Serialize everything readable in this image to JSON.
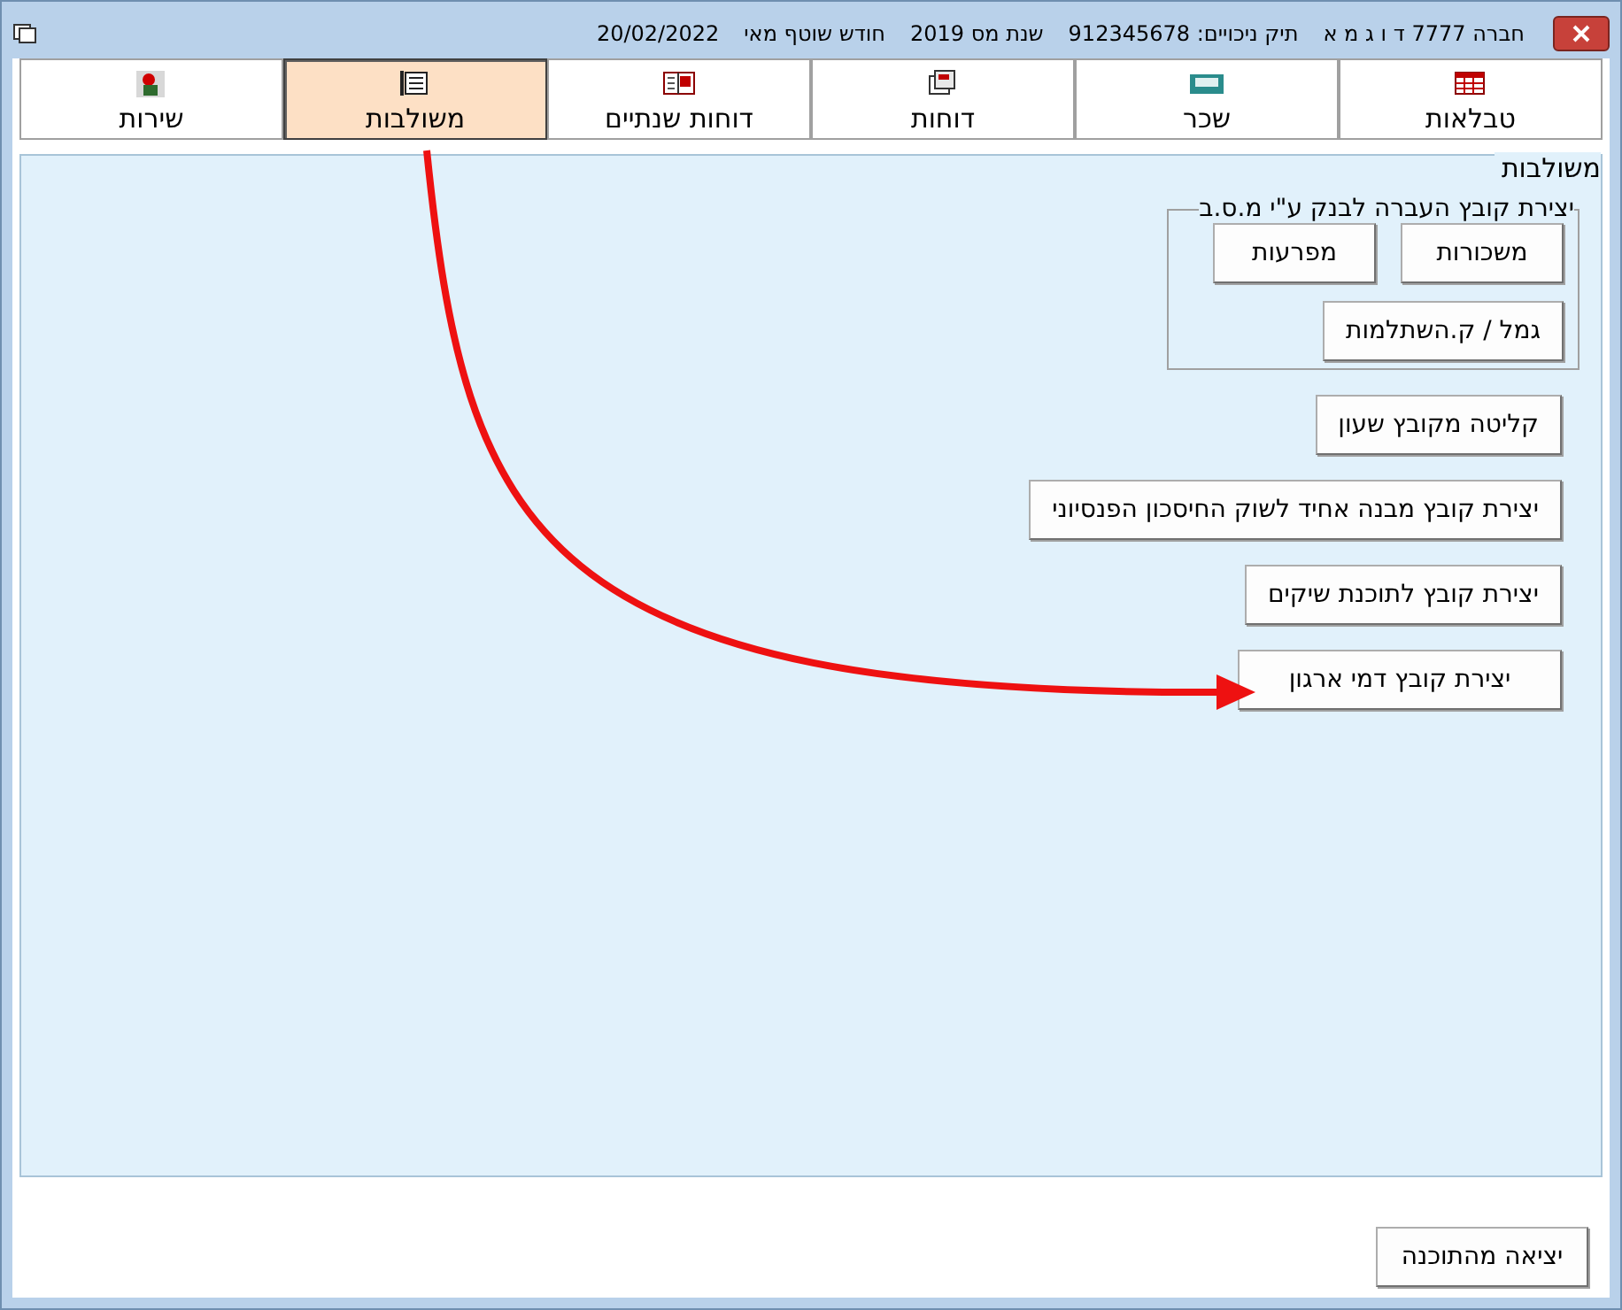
{
  "window": {
    "title_parts": [
      "חברה 7777 ד ו ג מ א",
      "תיק ניכויים: 912345678",
      "שנת מס 2019",
      "חודש שוטף מאי",
      "20/02/2022"
    ]
  },
  "tabs": [
    {
      "label": "טבלאות",
      "kind": "table",
      "selected": false
    },
    {
      "label": "שכר",
      "kind": "register",
      "selected": false
    },
    {
      "label": "דוחות",
      "kind": "report",
      "selected": false
    },
    {
      "label": "דוחות שנתיים",
      "kind": "calendar",
      "selected": false
    },
    {
      "label": "משולבות",
      "kind": "document",
      "selected": true
    },
    {
      "label": "שירות",
      "kind": "service",
      "selected": false
    }
  ],
  "panel": {
    "title": "משולבות",
    "bank_group": {
      "title": "יצירת קובץ העברה לבנק ע\"י מ.ס.ב",
      "buttons": [
        "משכורות",
        "מפרעות",
        "גמל / ק.השתלמות"
      ]
    },
    "buttons": [
      "קליטה מקובץ שעון",
      "יצירת קובץ מבנה אחיד לשוק החיסכון הפנסיוני",
      "יצירת קובץ לתוכנת שיקים",
      "יצירת קובץ דמי ארגון"
    ]
  },
  "exit_button": "יציאה מהתוכנה"
}
